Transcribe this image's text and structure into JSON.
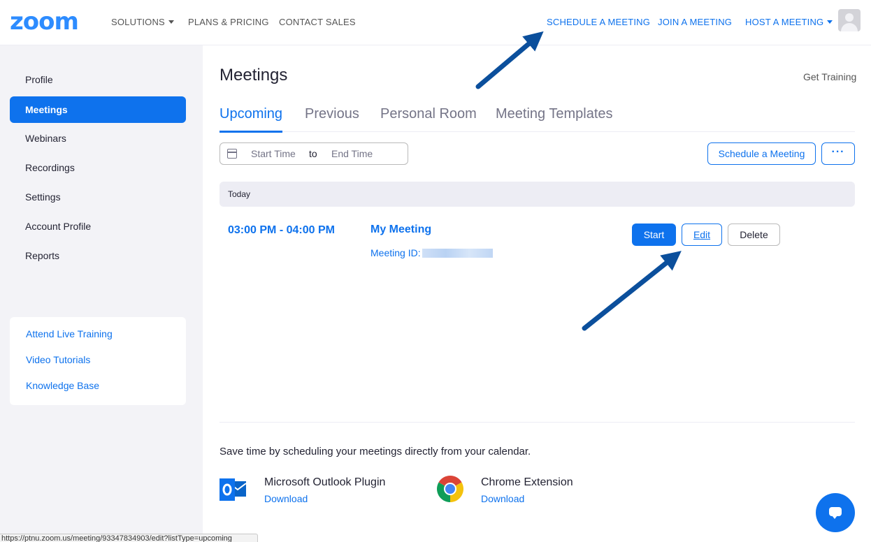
{
  "nav": {
    "logo": "zoom",
    "solutions": "SOLUTIONS",
    "plans": "PLANS & PRICING",
    "contact": "CONTACT SALES",
    "schedule": "SCHEDULE A MEETING",
    "join": "JOIN A MEETING",
    "host": "HOST A MEETING"
  },
  "sidebar": {
    "items": [
      {
        "label": "Profile"
      },
      {
        "label": "Meetings",
        "active": true
      },
      {
        "label": "Webinars"
      },
      {
        "label": "Recordings"
      },
      {
        "label": "Settings"
      },
      {
        "label": "Account Profile"
      },
      {
        "label": "Reports"
      }
    ],
    "help_links": [
      "Attend Live Training",
      "Video Tutorials",
      "Knowledge Base"
    ]
  },
  "main": {
    "title": "Meetings",
    "get_training": "Get Training",
    "tabs": [
      {
        "label": "Upcoming",
        "active": true
      },
      {
        "label": "Previous"
      },
      {
        "label": "Personal Room"
      },
      {
        "label": "Meeting Templates"
      }
    ],
    "date_range": {
      "start": "Start Time",
      "to": "to",
      "end": "End Time"
    },
    "schedule_button": "Schedule a Meeting",
    "more_button": "···",
    "day_header": "Today",
    "meeting": {
      "time": "03:00 PM - 04:00 PM",
      "topic": "My Meeting",
      "id_label": "Meeting ID:",
      "start": "Start",
      "edit": "Edit",
      "delete": "Delete"
    },
    "promo": "Save time by scheduling your meetings directly from your calendar.",
    "integrations": [
      {
        "name": "Microsoft Outlook Plugin",
        "link": "Download",
        "icon": "outlook-icon"
      },
      {
        "name": "Chrome Extension",
        "link": "Download",
        "icon": "chrome-icon"
      }
    ]
  },
  "status_bar": "https://ptnu.zoom.us/meeting/93347834903/edit?listType=upcoming",
  "colors": {
    "accent": "#0e72ed",
    "sidebar_bg": "#f3f3f7",
    "annotation_arrow": "#0b4f9c"
  }
}
